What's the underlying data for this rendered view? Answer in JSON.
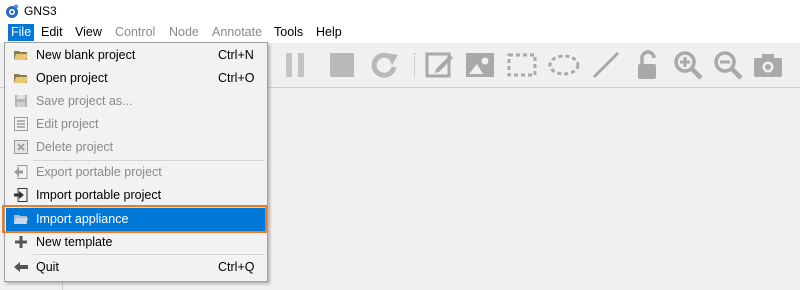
{
  "window": {
    "title": "GNS3",
    "icon": "gns3-logo-icon"
  },
  "menubar": {
    "items": [
      {
        "label": "File",
        "state": "active"
      },
      {
        "label": "Edit",
        "state": "enabled"
      },
      {
        "label": "View",
        "state": "enabled"
      },
      {
        "label": "Control",
        "state": "disabled"
      },
      {
        "label": "Node",
        "state": "disabled"
      },
      {
        "label": "Annotate",
        "state": "disabled"
      },
      {
        "label": "Tools",
        "state": "enabled"
      },
      {
        "label": "Help",
        "state": "enabled"
      }
    ]
  },
  "toolbar": {
    "icons": [
      "pause-icon",
      "stop-icon",
      "reload-icon",
      "add-note-icon",
      "insert-picture-icon",
      "draw-rectangle-icon",
      "draw-ellipse-icon",
      "draw-line-icon",
      "lock-icon",
      "zoom-in-icon",
      "zoom-out-icon",
      "screenshot-icon"
    ]
  },
  "file_menu": {
    "items": [
      {
        "label": "New blank project",
        "shortcut": "Ctrl+N",
        "enabled": true,
        "icon": "open-folder-icon"
      },
      {
        "label": "Open project",
        "shortcut": "Ctrl+O",
        "enabled": true,
        "icon": "open-folder-icon"
      },
      {
        "label": "Save project as...",
        "shortcut": "",
        "enabled": false,
        "icon": "save-icon"
      },
      {
        "label": "Edit project",
        "shortcut": "",
        "enabled": false,
        "icon": "edit-list-icon"
      },
      {
        "label": "Delete project",
        "shortcut": "",
        "enabled": false,
        "icon": "delete-icon"
      },
      {
        "label": "Export portable project",
        "shortcut": "",
        "enabled": false,
        "icon": "export-icon"
      },
      {
        "label": "Import portable project",
        "shortcut": "",
        "enabled": true,
        "icon": "import-icon"
      },
      {
        "label": "Import appliance",
        "shortcut": "",
        "enabled": true,
        "highlighted": true,
        "icon": "folder-icon"
      },
      {
        "label": "New template",
        "shortcut": "",
        "enabled": true,
        "icon": "plus-icon"
      },
      {
        "label": "Quit",
        "shortcut": "Ctrl+Q",
        "enabled": true,
        "icon": "back-arrow-icon"
      }
    ]
  },
  "colors": {
    "accent": "#0078d7",
    "highlight_frame": "#f07b1e",
    "disabled_text": "#8a8a8a"
  }
}
